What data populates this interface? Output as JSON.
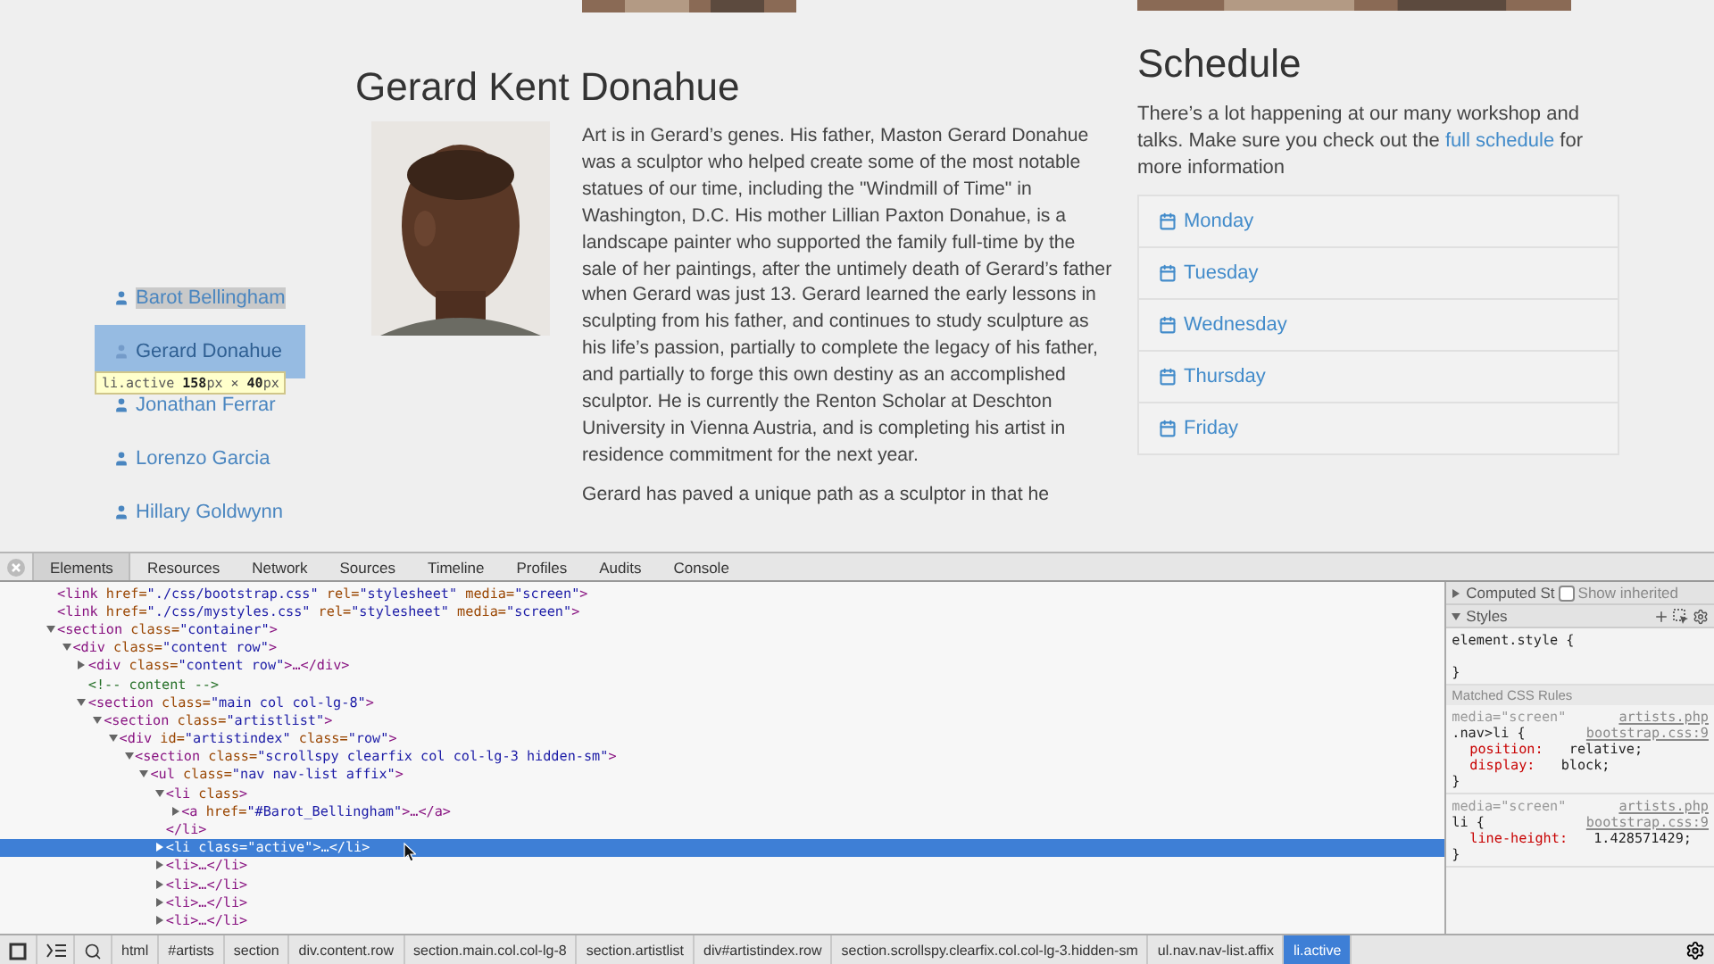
{
  "page": {
    "artist_nav": [
      {
        "name": "Barot Bellingham",
        "active": false,
        "text_selected": true
      },
      {
        "name": "Gerard Donahue",
        "active": true,
        "text_selected": false
      },
      {
        "name": "Jonathan Ferrar",
        "active": false,
        "text_selected": false
      },
      {
        "name": "Lorenzo Garcia",
        "active": false,
        "text_selected": false
      },
      {
        "name": "Hillary Goldwynn",
        "active": false,
        "text_selected": false
      }
    ],
    "inspect_tooltip": "li.active **158**px × **40**px",
    "artist": {
      "name": "Gerard Kent Donahue",
      "paragraphs": [
        "Art is in Gerard’s genes. His father, Maston Gerard Donahue was a sculptor who helped create some of the most notable statues of our time, including the \"Windmill of Time\" in Washington, D.C. His mother Lillian Paxton Donahue, is a landscape painter who supported the family full-time by the sale of her paintings, after the untimely death of Gerard’s father when Gerard was just 13. Gerard learned the early lessons in sculpting from his father, and continues to study sculpture as his life’s passion, partially to complete the legacy of his father, and partially to forge this own destiny as an accomplished sculptor. He is currently the Renton Scholar at Deschton University in Vienna Austria, and is completing his artist in residence commitment for the next year.",
        "Gerard has paved a unique path as a sculptor in that he"
      ]
    },
    "schedule": {
      "title": "Schedule",
      "intro_before": "There’s a lot happening at our many workshop and talks. Make sure you check out the",
      "link": "full schedule",
      "intro_after": "for more information",
      "days": [
        "Monday",
        "Tuesday",
        "Wednesday",
        "Thursday",
        "Friday"
      ]
    }
  },
  "devtools": {
    "tabs": [
      {
        "label": "Elements",
        "selected": true
      },
      {
        "label": "Resources",
        "selected": false
      },
      {
        "label": "Network",
        "selected": false
      },
      {
        "label": "Sources",
        "selected": false
      },
      {
        "label": "Timeline",
        "selected": false
      },
      {
        "label": "Profiles",
        "selected": false
      },
      {
        "label": "Audits",
        "selected": false
      },
      {
        "label": "Console",
        "selected": false
      }
    ],
    "tree": [
      {
        "text": "<link href=\"./css/bootstrap.css\" rel=\"stylesheet\" media=\"screen\">",
        "selected": false
      },
      {
        "text": "<link href=\"./css/mystyles.css\" rel=\"stylesheet\" media=\"screen\">",
        "selected": false
      },
      {
        "text": "<section class=\"container\">",
        "expanded": true,
        "selected": false,
        "children": [
          {
            "text": "<div class=\"content row\">",
            "expanded": true,
            "selected": false,
            "children": [
              {
                "text": "<div class=\"content row\">…</div>",
                "expanded": false,
                "selected": false
              },
              {
                "text": "<!-- content -->",
                "selected": false
              },
              {
                "text": "<section class=\"main col col-lg-8\">",
                "expanded": true,
                "selected": false,
                "children": [
                  {
                    "text": "<section class=\"artistlist\">",
                    "expanded": true,
                    "selected": false,
                    "children": [
                      {
                        "text": "<div id=\"artistindex\" class=\"row\">",
                        "expanded": true,
                        "selected": false,
                        "children": [
                          {
                            "text": "<section class=\"scrollspy clearfix col col-lg-3 hidden-sm\">",
                            "expanded": true,
                            "selected": false,
                            "children": [
                              {
                                "text": "<ul class=\"nav nav-list affix\">",
                                "expanded": true,
                                "selected": false,
                                "children": [
                                  {
                                    "text": "<li class>",
                                    "expanded": true,
                                    "selected": false,
                                    "closing": "</li>",
                                    "children": [
                                      {
                                        "text": "<a href=\"#Barot_Bellingham\">…</a>",
                                        "expanded": false,
                                        "selected": false
                                      }
                                    ]
                                  },
                                  {
                                    "text": "<li class=\"active\">…</li>",
                                    "expanded": false,
                                    "selected": true
                                  },
                                  {
                                    "text": "<li>…</li>",
                                    "expanded": false,
                                    "selected": false
                                  },
                                  {
                                    "text": "<li>…</li>",
                                    "expanded": false,
                                    "selected": false
                                  },
                                  {
                                    "text": "<li>…</li>",
                                    "expanded": false,
                                    "selected": false
                                  },
                                  {
                                    "text": "<li>…</li>",
                                    "expanded": false,
                                    "selected": false
                                  }
                                ]
                              }
                            ]
                          }
                        ]
                      }
                    ]
                  }
                ]
              }
            ]
          }
        ]
      }
    ],
    "side": {
      "computed": {
        "label": "Computed St",
        "expanded": false,
        "checkbox_label": "Show inherited",
        "checked": false
      },
      "styles": {
        "label": "Styles",
        "expanded": true
      },
      "element_style": {
        "selector": "element.style {",
        "closing": "}"
      },
      "matched_header": "Matched CSS Rules",
      "rules": [
        {
          "media": "media=\"screen\"",
          "page": "artists.php",
          "selector": ".nav>li {",
          "source": "bootstrap.css:9",
          "declarations": [
            {
              "property": "position:",
              "value": "relative;"
            },
            {
              "property": "display:",
              "value": "block;"
            }
          ],
          "closing": "}"
        },
        {
          "media": "media=\"screen\"",
          "page": "artists.php",
          "selector": "li {",
          "source": "bootstrap.css:9",
          "declarations": [
            {
              "property": "line-height:",
              "value": "1.428571429;"
            }
          ],
          "closing": "}"
        }
      ]
    },
    "breadcrumbs": [
      {
        "label": "html",
        "selected": false
      },
      {
        "label": "#artists",
        "selected": false
      },
      {
        "label": "section",
        "selected": false
      },
      {
        "label": "div.content.row",
        "selected": false
      },
      {
        "label": "section.main.col.col-lg-8",
        "selected": false
      },
      {
        "label": "section.artistlist",
        "selected": false
      },
      {
        "label": "div#artistindex.row",
        "selected": false
      },
      {
        "label": "section.scrollspy.clearfix.col.col-lg-3.hidden-sm",
        "selected": false
      },
      {
        "label": "ul.nav.nav-list.affix",
        "selected": false
      },
      {
        "label": "li.active",
        "selected": true
      }
    ]
  }
}
